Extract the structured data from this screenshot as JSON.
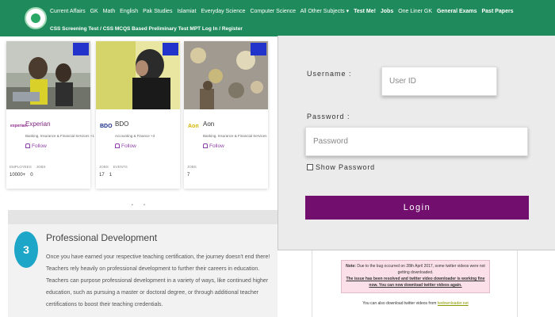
{
  "nav": {
    "items": [
      {
        "label": "Current Affairs",
        "bold": false
      },
      {
        "label": "GK",
        "bold": false
      },
      {
        "label": "Math",
        "bold": false
      },
      {
        "label": "English",
        "bold": false
      },
      {
        "label": "Pak Studies",
        "bold": false
      },
      {
        "label": "Islamiat",
        "bold": false
      },
      {
        "label": "Everyday Science",
        "bold": false
      },
      {
        "label": "Computer Science",
        "bold": false
      },
      {
        "label": "All Other Subjects ▾",
        "bold": false
      },
      {
        "label": "Test Me!",
        "bold": true
      },
      {
        "label": "Jobs",
        "bold": true
      },
      {
        "label": "One Liner GK",
        "bold": false
      },
      {
        "label": "General Exams",
        "bold": true
      },
      {
        "label": "Past Papers",
        "bold": true
      }
    ],
    "row2": "CSS Screening Test / CSS MCQS Based Preliminary Test MPT   Log In / Register"
  },
  "cards": [
    {
      "logo": "experian.",
      "name": "Experian",
      "industry": "Banking, Insurance & Financial Services +1",
      "follow": "Follow",
      "stat_labels": [
        "EMPLOYEES",
        "JOBS"
      ],
      "stat_values": [
        "10000+",
        "0"
      ]
    },
    {
      "logo": "BDO",
      "name": "BDO",
      "industry": "Accounting & Finance +3",
      "follow": "Follow",
      "stat_labels": [
        "JOBS",
        "EVENTS"
      ],
      "stat_values": [
        "17",
        "1"
      ]
    },
    {
      "logo": "Aon",
      "name": "Aon",
      "industry": "Banking, Insurance & Financial Services",
      "follow": "Follow",
      "stat_labels": [
        "JOBS"
      ],
      "stat_values": [
        "7"
      ]
    }
  ],
  "pager": "• •",
  "professional": {
    "number": "3",
    "title": "Professional Development",
    "text": "Once you have earned your respective teaching certification, the journey doesn't end there! Teachers rely heavily on professional development to further their careers in education. Teachers can purpose professional development in a variety of ways, like continued higher education, such as pursuing a master or doctoral degree, or through additional teacher certifications to boost their teaching credentials."
  },
  "login": {
    "username_label": "Username :",
    "username_placeholder": "User ID",
    "password_label": "Password :",
    "password_placeholder": "Password",
    "show_password": "Show Password",
    "button": "Login"
  },
  "notice": {
    "note_label": "Note:",
    "note_text": "Due to the bug occurred on 28th April 2017, some twitter videos were not getting downloaded.",
    "resolved_text": "The issue has been resolved and twitter video downloader is working fine now. You can now download twitter videos again.",
    "also_text": "You can also download twitter videos from",
    "also_link": "twdownloader.net"
  }
}
